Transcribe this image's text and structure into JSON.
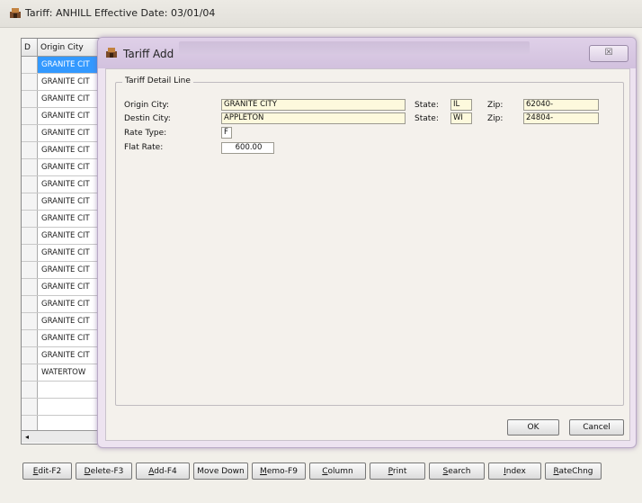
{
  "main_window": {
    "title": "Tariff: ANHILL  Effective Date: 03/01/04"
  },
  "grid": {
    "headers": [
      "D",
      "Origin City"
    ],
    "rows": [
      "GRANITE CIT",
      "GRANITE CIT",
      "GRANITE CIT",
      "GRANITE CIT",
      "GRANITE CIT",
      "GRANITE CIT",
      "GRANITE CIT",
      "GRANITE CIT",
      "GRANITE CIT",
      "GRANITE CIT",
      "GRANITE CIT",
      "GRANITE CIT",
      "GRANITE CIT",
      "GRANITE CIT",
      "GRANITE CIT",
      "GRANITE CIT",
      "GRANITE CIT",
      "GRANITE CIT",
      "WATERTOW"
    ],
    "selected_index": 0
  },
  "toolbar": {
    "buttons": [
      {
        "key": "E",
        "rest": "dit-F2"
      },
      {
        "key": "D",
        "rest": "elete-F3"
      },
      {
        "key": "A",
        "rest": "dd-F4"
      },
      {
        "key": "",
        "rest": "Move Down"
      },
      {
        "key": "M",
        "rest": "emo-F9"
      },
      {
        "key": "C",
        "rest": "olumn"
      },
      {
        "key": "P",
        "rest": "rint"
      },
      {
        "key": "S",
        "rest": "earch"
      },
      {
        "key": "I",
        "rest": "ndex"
      },
      {
        "key": "R",
        "rest": "ateChng"
      }
    ]
  },
  "dialog": {
    "title": "Tariff Add",
    "close_glyph": "☒",
    "group_title": "Tariff Detail Line",
    "origin_city_label": "Origin City:",
    "origin_city": "GRANITE CITY",
    "origin_state_label": "State:",
    "origin_state": "IL",
    "origin_zip_label": "Zip:",
    "origin_zip": "62040-",
    "destin_city_label": "Destin City:",
    "destin_city": "APPLETON",
    "destin_state_label": "State:",
    "destin_state": "WI",
    "destin_zip_label": "Zip:",
    "destin_zip": "24804-",
    "rate_type_label": "Rate Type:",
    "rate_type": "F",
    "flat_rate_label": "Flat Rate:",
    "flat_rate": "600.00",
    "ok_label": "OK",
    "cancel_label": "Cancel"
  },
  "colors": {
    "selection": "#3399ff",
    "field_bg": "#fdf9dd",
    "dialog_frame": "#ede3f0"
  }
}
